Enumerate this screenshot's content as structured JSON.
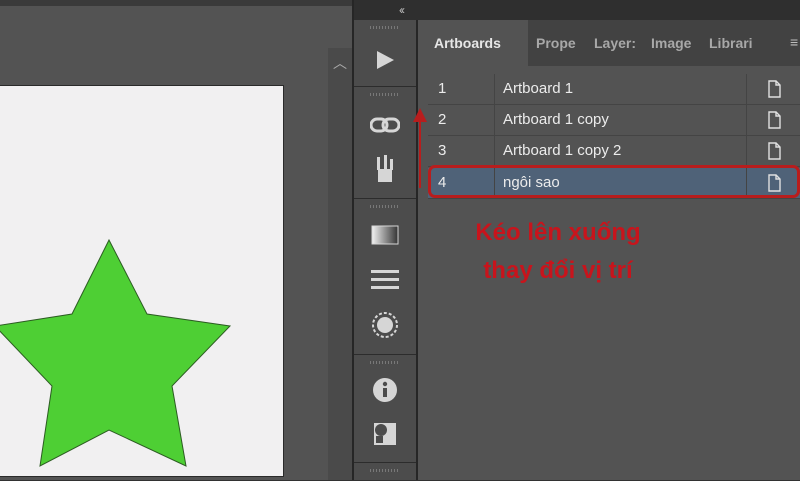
{
  "panel": {
    "tabs": [
      {
        "label": "Artboards"
      },
      {
        "label": "Prope"
      },
      {
        "label": "Layer:"
      },
      {
        "label": "Image"
      },
      {
        "label": "Librari"
      }
    ],
    "menu_glyph": "≡"
  },
  "artboards": [
    {
      "number": "1",
      "name": "Artboard 1"
    },
    {
      "number": "2",
      "name": "Artboard 1 copy"
    },
    {
      "number": "3",
      "name": "Artboard 1 copy 2"
    },
    {
      "number": "4",
      "name": "ngôi sao",
      "selected": true
    }
  ],
  "annotation": {
    "line1": "Kéo lên xuống",
    "line2": "thay đổi vị trí",
    "color": "#c8141c"
  },
  "strip_icons": [
    "play-icon",
    "link-icon",
    "brush-tools-icon",
    "gradient-icon",
    "align-lines-icon",
    "radial-glow-icon",
    "info-icon",
    "transform-icon"
  ],
  "collapse_glyph": "‹‹",
  "colors": {
    "star": "#4ecf34",
    "selection": "#4f6278",
    "highlight": "#b81d1d"
  }
}
